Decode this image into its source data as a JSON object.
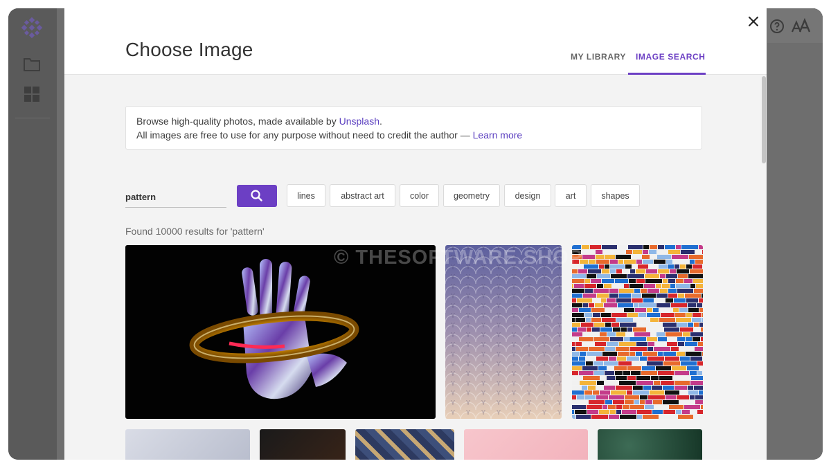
{
  "modal": {
    "title": "Choose Image",
    "tabs": [
      {
        "label": "MY LIBRARY",
        "active": false
      },
      {
        "label": "IMAGE SEARCH",
        "active": true
      }
    ],
    "close_icon": "close-icon"
  },
  "info": {
    "line1_prefix": "Browse high-quality photos, made available by ",
    "line1_link": "Unsplash",
    "line1_suffix": ".",
    "line2_prefix": "All images are free to use for any purpose without need to credit the author — ",
    "line2_link": "Learn more"
  },
  "search": {
    "query": "pattern",
    "button_icon": "search-icon"
  },
  "chips": [
    "lines",
    "abstract art",
    "color",
    "geometry",
    "design",
    "art",
    "shapes"
  ],
  "results": {
    "summary": "Found 10000 results for 'pattern'"
  },
  "watermark": "© THESOFTWARE.SHOP",
  "colors": {
    "accent": "#6c3fc4",
    "link": "#5b3fc0"
  },
  "app": {
    "rail_icons": [
      "logo-icon",
      "folder-icon",
      "grid-icon"
    ],
    "top_icons": [
      "help-icon",
      "text-size-icon"
    ]
  }
}
